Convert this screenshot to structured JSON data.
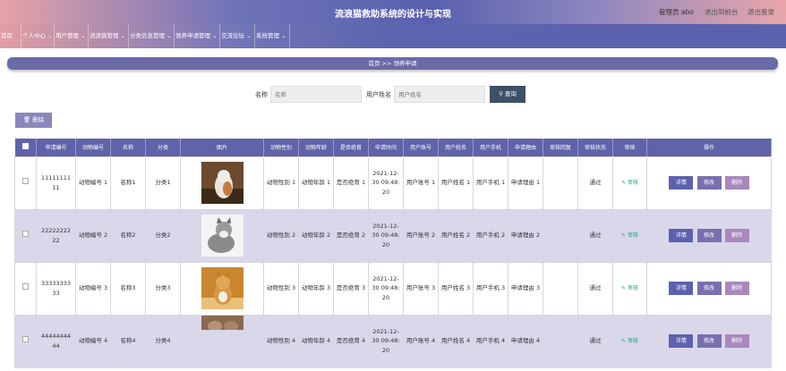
{
  "header": {
    "title": "流浪猫救助系统的设计与实现",
    "admin": "管理员 abo",
    "back_link": "退出到前台",
    "logout_link": "退出登录"
  },
  "nav": {
    "items": [
      "首页",
      "个人中心 ⌄",
      "用户管理 ⌄",
      "流浪猫管理 ⌄",
      "分类信息管理 ⌄",
      "领养申请管理 ⌄",
      "交流论坛 ⌄",
      "系统管理 ⌄"
    ]
  },
  "breadcrumb": "首页  >>  领养申请",
  "search": {
    "name_label": "名称",
    "name_placeholder": "名称",
    "user_label": "用户姓名",
    "user_placeholder": "用户姓名",
    "button": "查询"
  },
  "toolbar": {
    "delete": "删除"
  },
  "table": {
    "headers": [
      "申请编号",
      "动物编号",
      "名称",
      "分类",
      "图片",
      "动物性别",
      "动物年龄",
      "是否绝育",
      "申请时间",
      "用户账号",
      "用户姓名",
      "用户手机",
      "申请理由",
      "审核回复",
      "审核状态",
      "审核",
      "操作"
    ],
    "review_label": "审核",
    "ops": {
      "detail": "详情",
      "edit": "修改",
      "remove": "删除"
    },
    "rows": [
      {
        "id": "11111111 11",
        "animal_no": "动物编号 1",
        "name": "名称1",
        "category": "分类1",
        "gender": "动物性别 1",
        "age": "动物年龄 1",
        "neutered": "是否绝育 1",
        "time": "2021-12- 30 09:48: 20",
        "account": "用户账号 1",
        "username": "用户姓名 1",
        "phone": "用户手机 1",
        "reason": "申请理由 1",
        "reply": "",
        "status": "通过"
      },
      {
        "id": "22222222 22",
        "animal_no": "动物编号 2",
        "name": "名称2",
        "category": "分类2",
        "gender": "动物性别 2",
        "age": "动物年龄 2",
        "neutered": "是否绝育 2",
        "time": "2021-12- 30 09:48: 20",
        "account": "用户账号 2",
        "username": "用户姓名 2",
        "phone": "用户手机 2",
        "reason": "申请理由 2",
        "reply": "",
        "status": "通过"
      },
      {
        "id": "33333333 33",
        "animal_no": "动物编号 3",
        "name": "名称3",
        "category": "分类3",
        "gender": "动物性别 3",
        "age": "动物年龄 3",
        "neutered": "是否绝育 3",
        "time": "2021-12- 30 09:48: 20",
        "account": "用户账号 3",
        "username": "用户姓名 3",
        "phone": "用户手机 3",
        "reason": "申请理由 3",
        "reply": "",
        "status": "通过"
      },
      {
        "id": "44444444 44",
        "animal_no": "动物编号 4",
        "name": "名称4",
        "category": "分类4",
        "gender": "动物性别 4",
        "age": "动物年龄 4",
        "neutered": "是否绝育 4",
        "time": "2021-12- 30 09:48: 20",
        "account": "用户账号 4",
        "username": "用户姓名 4",
        "phone": "用户手机 4",
        "reason": "申请理由 4",
        "reply": "",
        "status": "通过"
      }
    ]
  }
}
